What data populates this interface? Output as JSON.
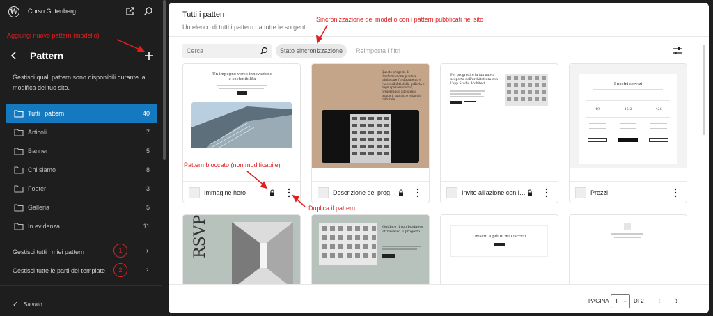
{
  "sidebar": {
    "site_title": "Corso Gutenberg",
    "heading": "Pattern",
    "description": "Gestisci quali pattern sono disponibili durante la modifica del tuo sito.",
    "categories": [
      {
        "label": "Tutti i pattern",
        "count": "40",
        "active": true
      },
      {
        "label": "Articoli",
        "count": "7"
      },
      {
        "label": "Banner",
        "count": "5"
      },
      {
        "label": "Chi siamo",
        "count": "8"
      },
      {
        "label": "Footer",
        "count": "3"
      },
      {
        "label": "Galleria",
        "count": "5"
      },
      {
        "label": "In evidenza",
        "count": "11"
      }
    ],
    "manage_patterns": "Gestisci tutti i miei pattern",
    "manage_template_parts": "Gestisci tutte le parti del template",
    "saved": "Salvato"
  },
  "annotations": {
    "add_pattern": "Aggiungi nuovo pattern (modello)",
    "sync": "Sincronizzazione del modello con i pattern pubblicati nel sito",
    "locked": "Pattern bloccato (non modificabile)",
    "duplicate": "Duplica il pattern",
    "circle_1": "1",
    "circle_2": "2"
  },
  "main": {
    "title": "Tutti i pattern",
    "subtitle": "Un elenco di tutti i pattern da tutte le sorgenti.",
    "search_placeholder": "Cerca",
    "sync_button": "Stato sincronizzazione",
    "reset_button": "Reimposta i filtri",
    "cards": [
      {
        "name": "Immagine hero",
        "preview_title": "Un impegno verso innovazione e sostenibilità"
      },
      {
        "name": "Descrizione del progetto",
        "preview_title": "Questo progetto di trasformazione punta a migliorare l'ordinamento e l'accessibilità della galleria e degli spazi espositivi, preservando allo stesso tempo il suo ricco retaggio culturale."
      },
      {
        "name": "Invito all'azione con immagine",
        "preview_title": "Per progredire la tua nuova scoperta dell'architettura con l'app Studio Architect."
      },
      {
        "name": "Prezzi",
        "preview_title": "I nostri servizi",
        "preview_prices": [
          "49",
          "45.2",
          "426"
        ]
      }
    ],
    "cards_row2": [
      {
        "preview_title": "RSVP"
      },
      {
        "preview_title": "Guidare il tuo business attraverso il progetto"
      },
      {
        "preview_title": "Unisciti a più di 900 iscritti"
      },
      {
        "preview_title": ""
      }
    ],
    "pagination": {
      "label": "PAGINA",
      "current": "1",
      "of": "DI 2"
    }
  },
  "colors": {
    "accent": "#1479bf",
    "annotation": "#e01e1e",
    "sidebar_bg": "#1e1e1e"
  }
}
